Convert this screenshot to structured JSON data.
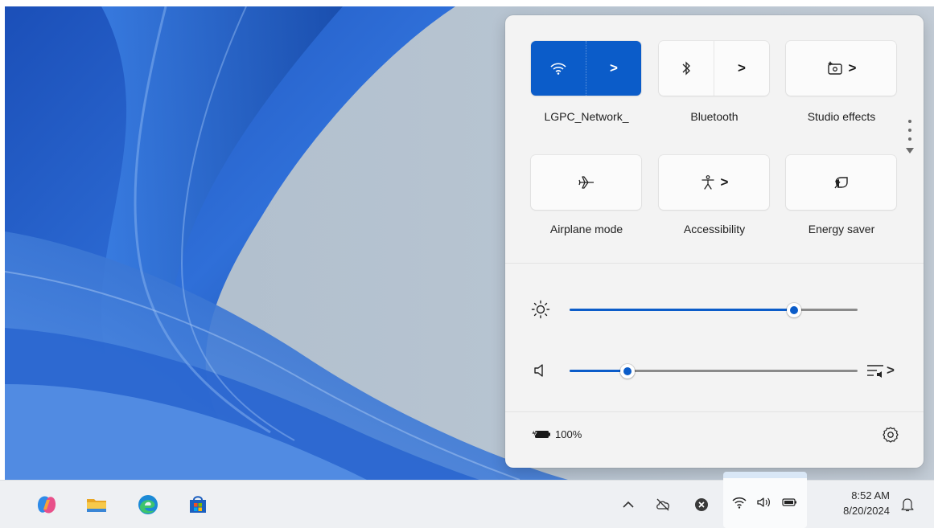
{
  "quick_settings": {
    "tiles": [
      {
        "id": "wifi",
        "label": "LGPC_Network_",
        "icon": "wifi-icon",
        "active": true,
        "has_chevron": true
      },
      {
        "id": "bluetooth",
        "label": "Bluetooth",
        "icon": "bluetooth-icon",
        "active": false,
        "has_chevron": true
      },
      {
        "id": "studio",
        "label": "Studio effects",
        "icon": "studio-effects-icon",
        "active": false,
        "has_chevron": true
      },
      {
        "id": "airplane",
        "label": "Airplane mode",
        "icon": "airplane-icon",
        "active": false,
        "has_chevron": false
      },
      {
        "id": "accessibility",
        "label": "Accessibility",
        "icon": "accessibility-icon",
        "active": false,
        "has_chevron": true
      },
      {
        "id": "energy",
        "label": "Energy saver",
        "icon": "energy-saver-icon",
        "active": false,
        "has_chevron": false
      }
    ],
    "chevron_glyph": ">",
    "brightness": {
      "icon": "brightness-icon",
      "value_fraction": 0.78
    },
    "volume": {
      "icon": "speaker-icon",
      "value_fraction": 0.2,
      "output_icon": "audio-output-icon",
      "output_chevron": ">"
    },
    "battery": {
      "icon": "battery-charging-icon",
      "text": "100%"
    },
    "settings_icon": "gear-icon"
  },
  "colors": {
    "accent": "#0b5cc9",
    "panel_bg": "#f3f3f3",
    "tile_bg": "#fbfbfb"
  },
  "taskbar": {
    "apps": [
      "copilot-icon",
      "file-explorer-icon",
      "edge-icon",
      "store-icon"
    ],
    "tray": {
      "overflow_icon": "chevron-up-icon",
      "cloud_icon": "onedrive-offline-icon",
      "status_icon": "close-circle-icon",
      "network_icon": "wifi-icon",
      "volume_icon": "speaker-icon",
      "battery_icon": "battery-icon"
    },
    "clock": {
      "time": "8:52 AM",
      "date": "8/20/2024"
    },
    "notification_icon": "notification-bell-icon"
  }
}
